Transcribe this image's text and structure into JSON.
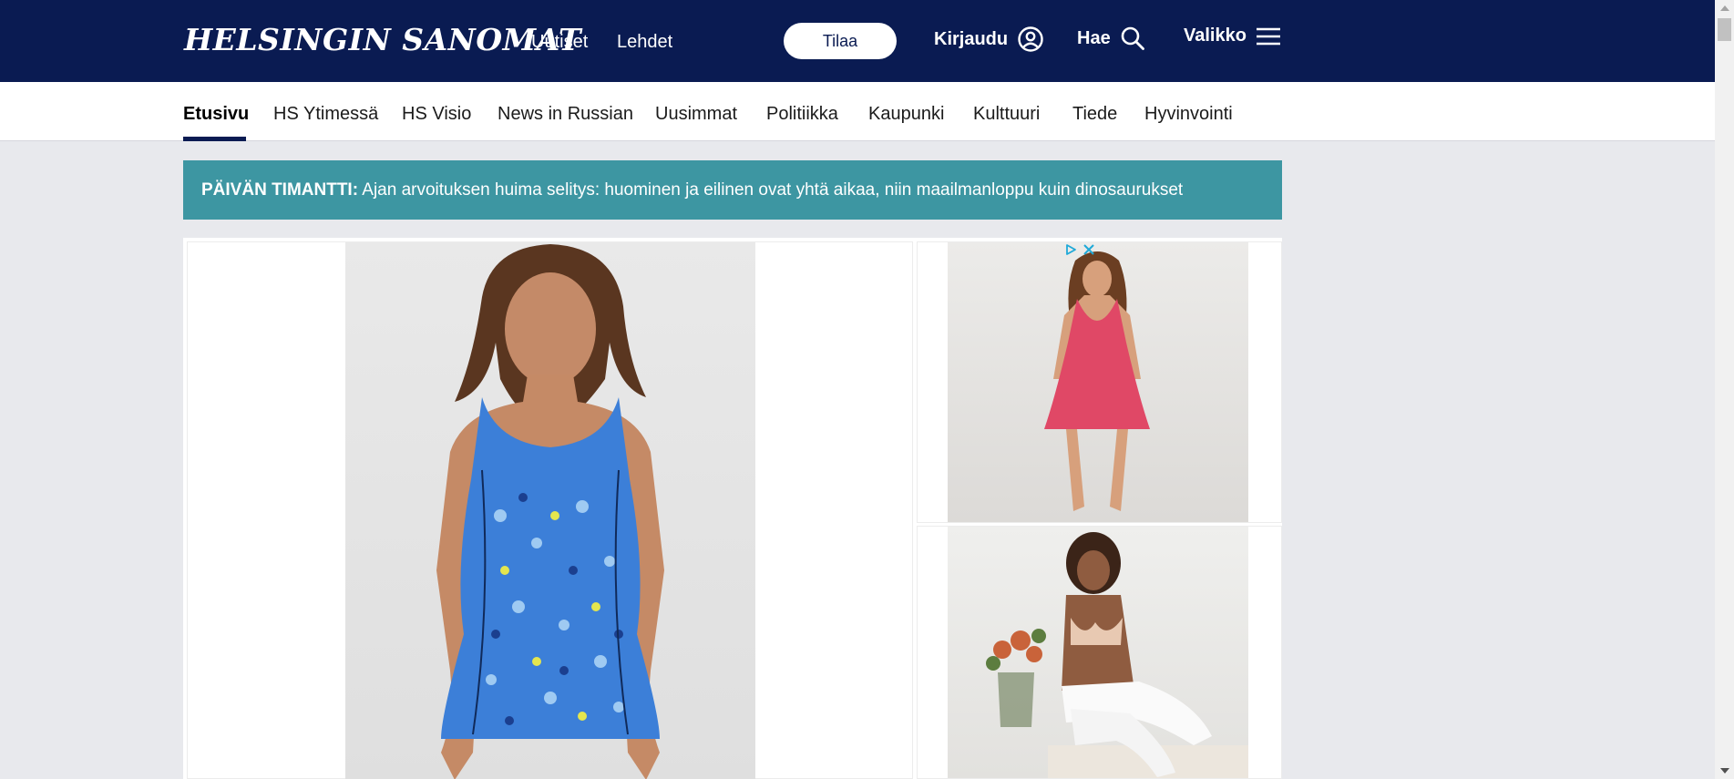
{
  "header": {
    "logo": "HELSINGIN SANOMAT",
    "links": [
      "Uutiset",
      "Lehdet"
    ],
    "subscribe_label": "Tilaa",
    "login_label": "Kirjaudu",
    "search_label": "Hae",
    "menu_label": "Valikko",
    "colors": {
      "background": "#0a1b52",
      "text": "#ffffff"
    }
  },
  "nav": {
    "items": [
      "Etusivu",
      "HS Ytimessä",
      "HS Visio",
      "News in Russian",
      "Uusimmat",
      "Politiikka",
      "Kaupunki",
      "Kulttuuri",
      "Tiede",
      "Hyvinvointi"
    ],
    "active": "Etusivu"
  },
  "banner": {
    "prefix": "PÄIVÄN TIMANTTI:",
    "text": "Ajan arvoituksen huima selitys: huominen ja eilinen ovat yhtä aikaa, niin maailmanloppu kuin dinosaurukset",
    "color": "#3d96a2"
  },
  "ad": {
    "icons": [
      "adchoices-icon",
      "close-icon"
    ],
    "accent": "#1fa9d8"
  }
}
